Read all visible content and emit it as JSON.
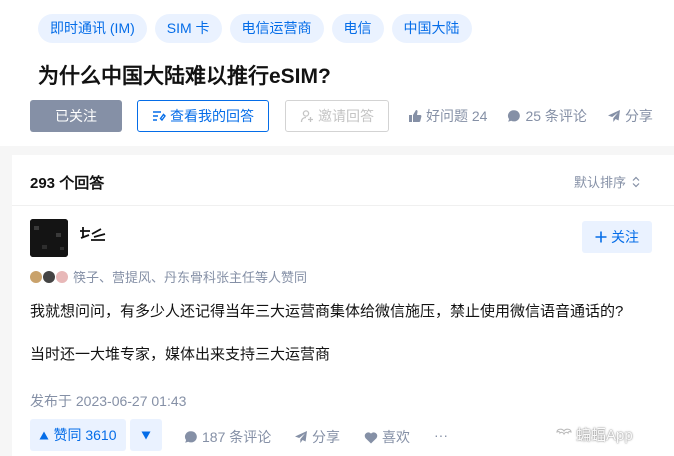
{
  "tags": [
    "即时通讯 (IM)",
    "SIM 卡",
    "电信运营商",
    "电信",
    "中国大陆"
  ],
  "question_title": "为什么中国大陆难以推行eSIM?",
  "actions": {
    "followed_label": "已关注",
    "my_answer_label": "查看我的回答",
    "invite_label": "邀请回答",
    "good_question_label": "好问题 24",
    "comments_label": "25 条评论",
    "share_label": "分享",
    "more_label": "·"
  },
  "answers": {
    "count_label": "293 个回答",
    "sort_label": "默认排序"
  },
  "answer": {
    "author_name": "",
    "follow_label": "关注",
    "voters_text": "筷子、营提风、丹东骨科张主任等人赞同",
    "paragraph1": "我就想问问，有多少人还记得当年三大运营商集体给微信施压，禁止使用微信语音通话的?",
    "paragraph2": "当时还一大堆专家，媒体出来支持三大运营商",
    "published": "发布于 2023-06-27 01:43",
    "upvote_label": "赞同 3610",
    "comments_label": "187 条评论",
    "share_label": "分享",
    "like_label": "喜欢",
    "more_label": "···"
  },
  "watermark": "蝙蝠App",
  "colors": {
    "accent": "#056de8",
    "accent_bg": "#eaf2ff",
    "muted": "#8590a6",
    "followed_bg": "#8590a6"
  }
}
